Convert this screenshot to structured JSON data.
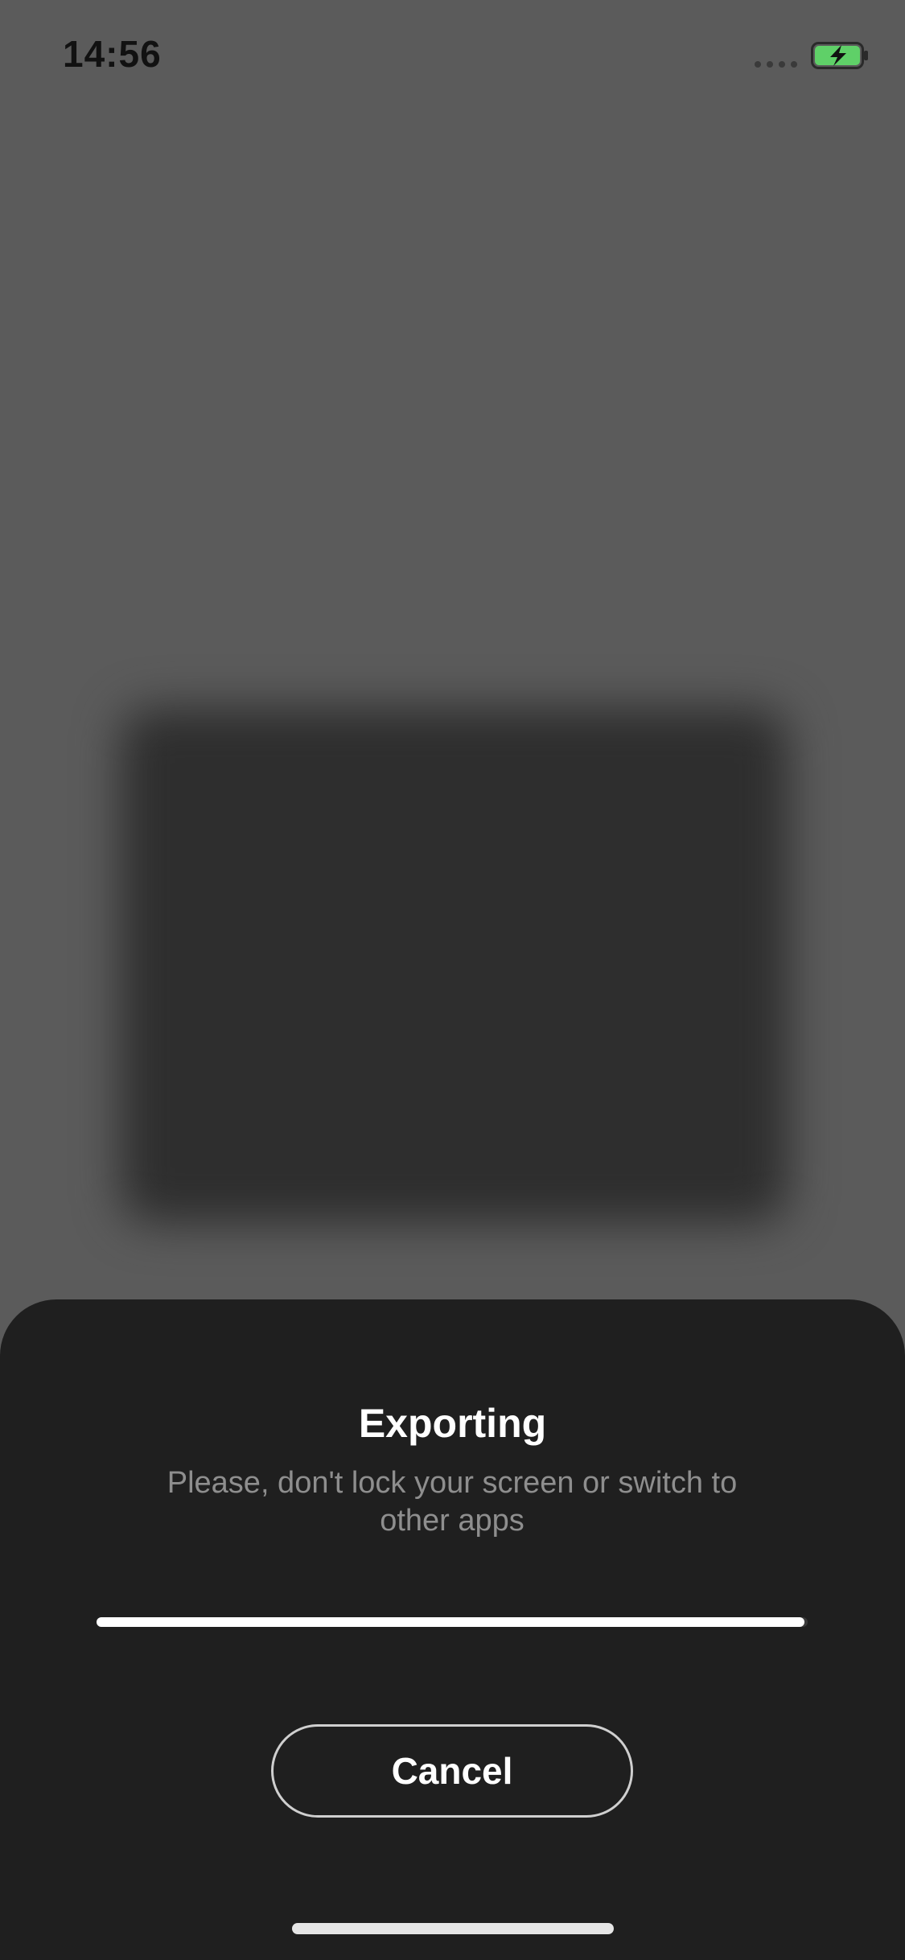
{
  "status_bar": {
    "time": "14:56",
    "battery_icon": "battery-charging-icon",
    "signal_icon": "signal-dots-icon",
    "battery_color": "#5fd068"
  },
  "export_sheet": {
    "title": "Exporting",
    "subtitle": "Please, don't lock your screen or switch to other apps",
    "progress": 0.995,
    "cancel_label": "Cancel"
  },
  "colors": {
    "background": "#5b5b5b",
    "sheet": "#1f1f1f",
    "subtitle_text": "#8e8e8e",
    "accent": "#ffffff"
  }
}
